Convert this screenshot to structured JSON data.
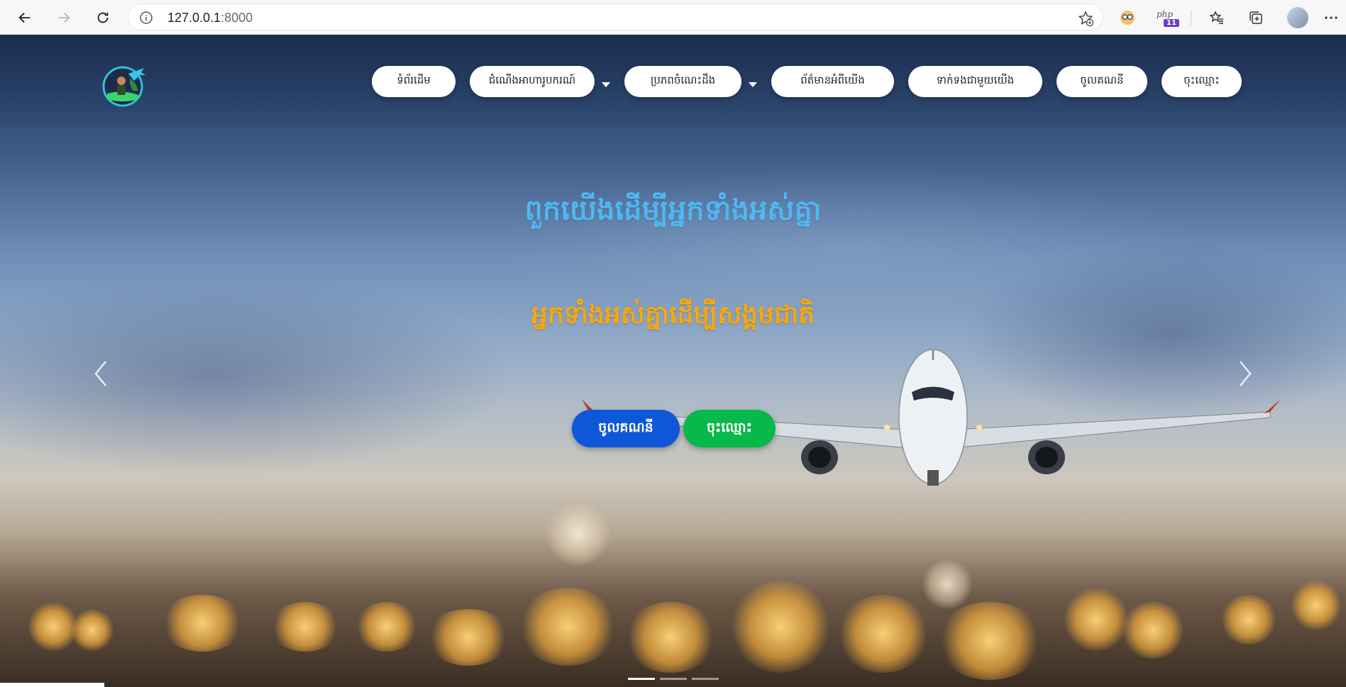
{
  "browser": {
    "url_host": "127.0.0.1",
    "url_port": ":8000",
    "extension_badge_text": "php",
    "extension_badge_number": "11"
  },
  "nav": {
    "items": [
      {
        "label": "ទំព័រដើម"
      },
      {
        "label": "ជំណើងអាហារូបករណ៍"
      },
      {
        "label": "ប្រភពចំណេះដឹង"
      },
      {
        "label": "ព័ត៌មានអំពីយើង"
      },
      {
        "label": "ទាក់ទងជាមួយយើង"
      },
      {
        "label": "ចូលគណនី"
      },
      {
        "label": "ចុះឈ្មោះ"
      }
    ]
  },
  "hero": {
    "title": "ពួកយើងដើម្បីអ្នកទាំងអស់គ្នា",
    "subtitle": "អ្នកទាំងអស់គ្នាដើម្បីសង្គមជាតិ",
    "login_button": "ចូលគណនី",
    "signup_button": "ចុះឈ្មោះ",
    "slide_count": 3,
    "active_slide": 1
  },
  "colors": {
    "title": "#4fb7f2",
    "subtitle": "#f7a70f",
    "login_button": "#0d57d8",
    "signup_button": "#07b94a"
  }
}
